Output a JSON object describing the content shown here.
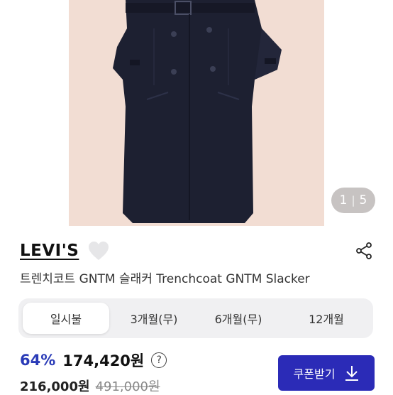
{
  "gallery": {
    "current": "1",
    "separator": "|",
    "total": "5",
    "image_icon": "trench-coat-photo"
  },
  "product": {
    "brand": "LEVI'S",
    "title": "트렌치코트 GNTM 슬래커 Trenchcoat GNTM Slacker",
    "wishlist_icon": "heart-icon",
    "share_icon": "share-icon"
  },
  "tabs": [
    {
      "label": "일시불",
      "active": true
    },
    {
      "label": "3개월(무)",
      "active": false
    },
    {
      "label": "6개월(무)",
      "active": false
    },
    {
      "label": "12개월",
      "active": false
    }
  ],
  "pricing": {
    "discount": "64%",
    "price": "174,420원",
    "help": "?",
    "list_price": "216,000원",
    "original_price": "491,000원"
  },
  "coupon": {
    "label": "쿠폰받기",
    "icon": "download-arrow-icon"
  },
  "colors": {
    "accent": "#2a3bb7",
    "button": "#2b2bb7",
    "photo_bg": "#f2ddd3"
  }
}
